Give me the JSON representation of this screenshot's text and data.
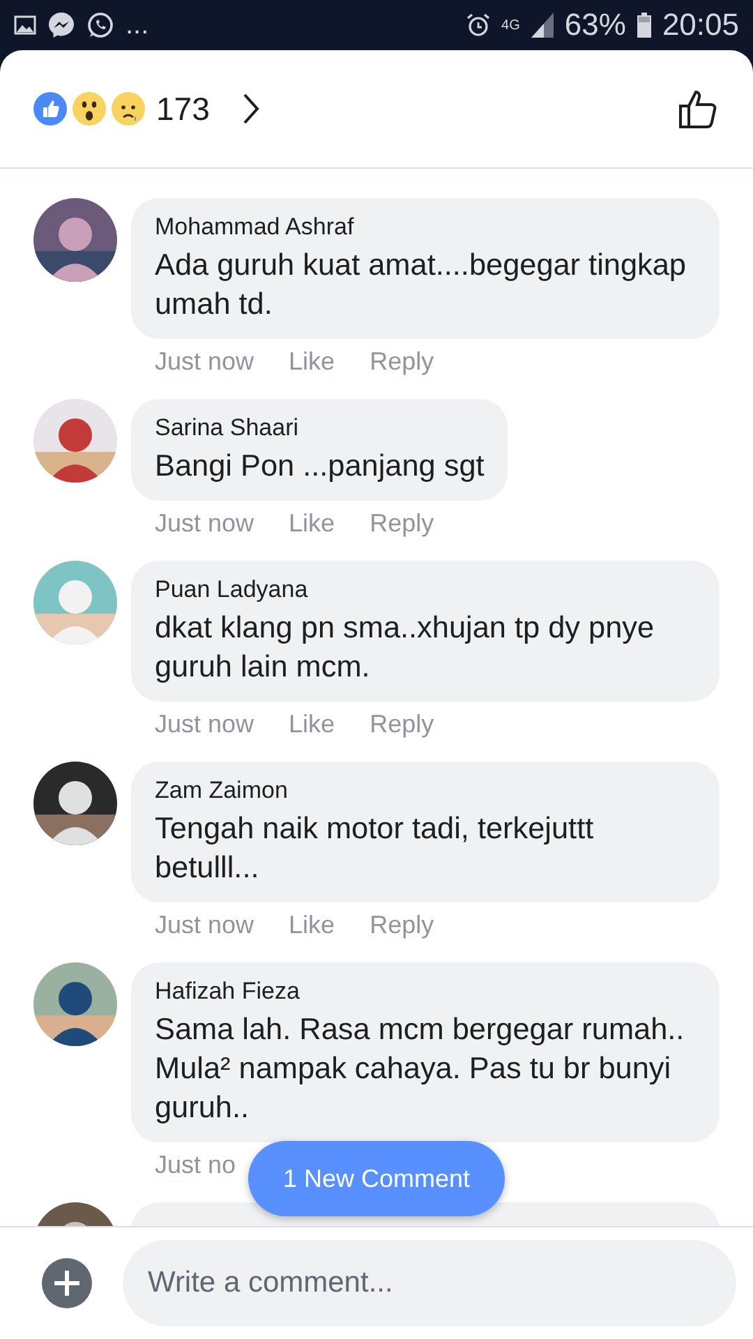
{
  "status_bar": {
    "more": "...",
    "network": "4G",
    "battery": "63%",
    "time": "20:05"
  },
  "reactions": {
    "count": "173"
  },
  "comments": [
    {
      "kind": "full",
      "author": "Mohammad Ashraf",
      "text": "Ada guruh kuat amat....begegar tingkap umah td.",
      "time": "Just now",
      "like": "Like",
      "reply": "Reply"
    },
    {
      "kind": "full",
      "author": "Sarina Shaari",
      "text": "Bangi Pon ...panjang sgt",
      "time": "Just now",
      "like": "Like",
      "reply": "Reply"
    },
    {
      "kind": "full",
      "author": "Puan Ladyana",
      "text": "dkat klang pn sma..xhujan tp dy pnye guruh lain mcm.",
      "time": "Just now",
      "like": "Like",
      "reply": "Reply"
    },
    {
      "kind": "full",
      "author": "Zam Zaimon",
      "text": "Tengah naik motor tadi, terkejuttt betulll...",
      "time": "Just now",
      "like": "Like",
      "reply": "Reply"
    },
    {
      "kind": "full",
      "author": "Hafizah Fieza",
      "text": "Sama lah. Rasa mcm bergegar rumah.. Mula² nampak cahaya. Pas tu br bunyi guruh..",
      "time": "Just no"
    },
    {
      "kind": "cut"
    }
  ],
  "new_comment_button": "1 New Comment",
  "composer": {
    "placeholder": "Write a comment..."
  }
}
